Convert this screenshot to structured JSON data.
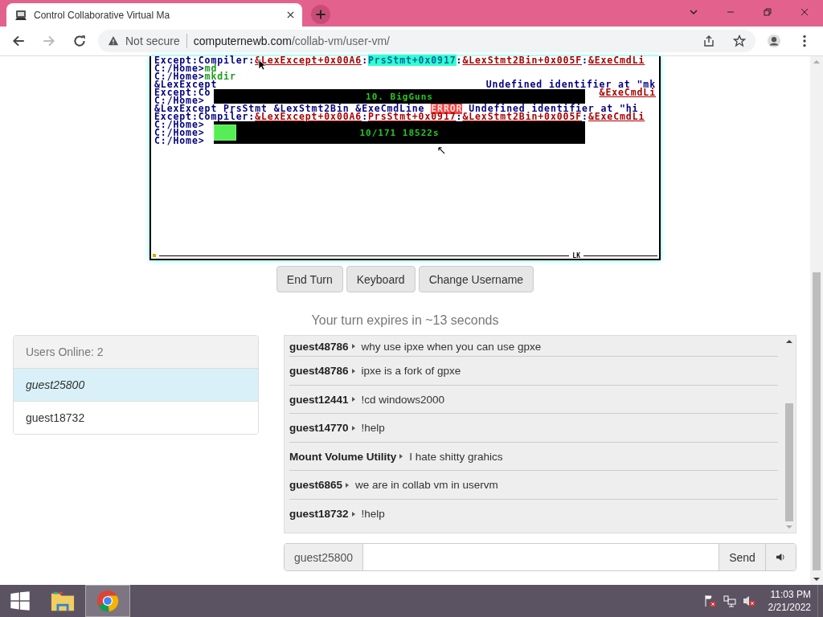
{
  "browser": {
    "tab": {
      "title": "Control Collaborative Virtual Ma",
      "selected": true
    },
    "address": {
      "security": "Not secure",
      "domain": "computernewb.com",
      "path": "/collab-vm/user-vm/"
    },
    "forward_disabled": true
  },
  "vm_screen": {
    "lines": [
      {
        "left": [
          {
            "text": "Except:Compiler:",
            "kind": "plain"
          },
          {
            "text": "&LexExcept+0x00A6",
            "kind": "link"
          },
          {
            "text": ":",
            "kind": "plain"
          },
          {
            "text": "PrsStmt+0x0917",
            "kind": "highlight"
          },
          {
            "text": ":",
            "kind": "plain"
          },
          {
            "text": "&LexStmt2Bin+0x005F",
            "kind": "link"
          },
          {
            "text": ":",
            "kind": "plain"
          },
          {
            "text": "&ExeCmdLi",
            "kind": "link"
          }
        ]
      },
      {
        "left": [
          {
            "text": "C:/Home>",
            "kind": "plain"
          },
          {
            "text": "md",
            "kind": "command"
          }
        ]
      },
      {
        "left": [
          {
            "text": "C:/Home>",
            "kind": "plain"
          },
          {
            "text": "mkdir",
            "kind": "command"
          }
        ]
      },
      {
        "left": [
          {
            "text": "&LexExcept",
            "kind": "plain"
          }
        ],
        "right": [
          {
            "text": "Undefined identifier at \"mk",
            "kind": "plain"
          }
        ]
      },
      {
        "left": [
          {
            "text": "Except:Co",
            "kind": "plain"
          }
        ],
        "right": [
          {
            "text": "&ExeCmdLi",
            "kind": "link"
          }
        ]
      },
      {
        "left": [
          {
            "text": "C:/Home>",
            "kind": "plain"
          }
        ]
      },
      {
        "left": [
          {
            "text": "&LexExcept PrsStmt &LexStmt2Bin &ExeCmdLine ",
            "kind": "plain"
          },
          {
            "text": "ERROR",
            "kind": "error"
          },
          {
            "text": " Undefined identifier at \"hi",
            "kind": "plain"
          }
        ]
      },
      {
        "left": [
          {
            "text": "Except:Compiler:",
            "kind": "plain"
          },
          {
            "text": "&LexExcept+0x00A6",
            "kind": "link"
          },
          {
            "text": ":",
            "kind": "plain"
          },
          {
            "text": "PrsStmt+0x0917",
            "kind": "link"
          },
          {
            "text": ":",
            "kind": "plain"
          },
          {
            "text": "&LexStmt2Bin+0x005F",
            "kind": "link"
          },
          {
            "text": ":",
            "kind": "plain"
          },
          {
            "text": "&ExeCmdLi",
            "kind": "link"
          }
        ]
      },
      {
        "left": [
          {
            "text": "C:/Home>",
            "kind": "plain"
          }
        ]
      },
      {
        "left": [
          {
            "text": "C:/Home>",
            "kind": "plain"
          }
        ]
      },
      {
        "left": [
          {
            "text": "C:/Home>",
            "kind": "plain"
          }
        ]
      }
    ],
    "banner": "10. BigGuns",
    "progress": {
      "text": "10/171 18522s",
      "level": 0.06
    },
    "status": "LK"
  },
  "buttons": [
    "End Turn",
    "Keyboard",
    "Change Username"
  ],
  "turn_notice": "Your turn expires in ~13 seconds",
  "users": {
    "header": "Users Online: 2",
    "items": [
      {
        "name": "guest25800",
        "selected": true
      },
      {
        "name": "guest18732",
        "selected": false
      }
    ]
  },
  "chat": {
    "messages": [
      {
        "user": "guest48786",
        "text": "why use ipxe when you can use gpxe"
      },
      {
        "user": "guest48786",
        "text": "ipxe is a fork of gpxe"
      },
      {
        "user": "guest12441",
        "text": "!cd windows2000"
      },
      {
        "user": "guest14770",
        "text": "!help"
      },
      {
        "user": "Mount Volume Utility",
        "text": "I hate shitty grahics"
      },
      {
        "user": "guest6865",
        "text": "we are in collab vm in uservm"
      },
      {
        "user": "guest18732",
        "text": "!help"
      }
    ],
    "username": "guest25800",
    "send": "Send"
  },
  "taskbar": {
    "apps": [
      {
        "kind": "explorer",
        "selected": false
      },
      {
        "kind": "chrome",
        "selected": true
      }
    ],
    "time": "11:03 PM",
    "date": "2/21/2022"
  }
}
